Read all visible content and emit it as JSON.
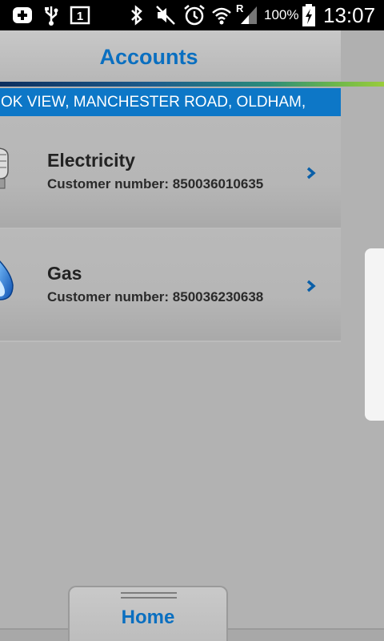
{
  "status_bar": {
    "battery_percent": "100%",
    "time": "13:07",
    "notification_badge": "1",
    "roaming_indicator": "R",
    "icons": [
      "plus-notification-icon",
      "usb-icon",
      "sim-notification-icon",
      "bluetooth-icon",
      "mute-icon",
      "alarm-icon",
      "wifi-icon",
      "signal-icon",
      "battery-charging-icon"
    ]
  },
  "header": {
    "title": "Accounts"
  },
  "address": {
    "text": "OK VIEW, MANCHESTER ROAD, OLDHAM,"
  },
  "accounts": [
    {
      "name": "Electricity",
      "customer_number": "Customer number: 850036010635",
      "icon": "lightbulb-icon"
    },
    {
      "name": "Gas",
      "customer_number": "Customer number: 850036230638",
      "icon": "gas-flame-icon"
    }
  ],
  "bottom_tab": {
    "label": "Home"
  },
  "colors": {
    "accent": "#0a6fc0",
    "address_bar": "#0d77c7",
    "background": "#b2b2b2"
  }
}
